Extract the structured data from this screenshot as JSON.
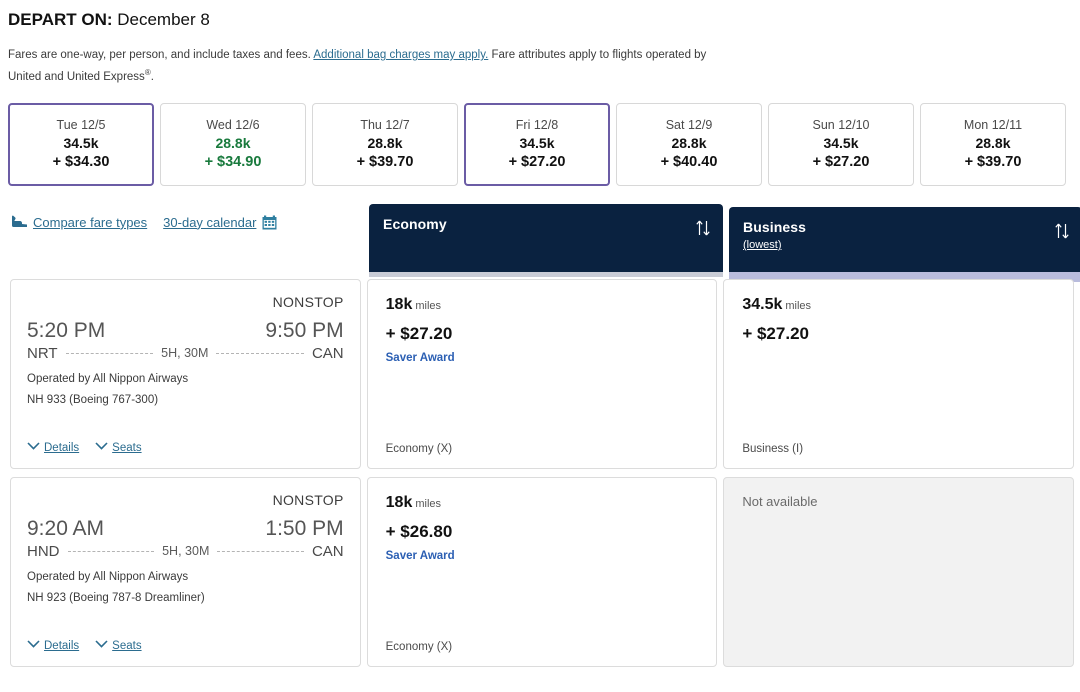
{
  "header": {
    "depart_label": "DEPART ON:",
    "depart_date": "December 8",
    "note_part1": "Fares are one-way, per person, and include taxes and fees.",
    "note_link": "Additional bag charges may apply.",
    "note_part2": "Fare attributes apply to flights operated by United and United Express",
    "note_sup": "®",
    "note_end": "."
  },
  "date_strip": [
    {
      "dow": "Tue 12/5",
      "miles": "34.5k",
      "cash": "+ $34.30",
      "selected": true,
      "lowest": false
    },
    {
      "dow": "Wed 12/6",
      "miles": "28.8k",
      "cash": "+ $34.90",
      "selected": false,
      "lowest": true
    },
    {
      "dow": "Thu 12/7",
      "miles": "28.8k",
      "cash": "+ $39.70",
      "selected": false,
      "lowest": false
    },
    {
      "dow": "Fri 12/8",
      "miles": "34.5k",
      "cash": "+ $27.20",
      "selected": true,
      "lowest": false
    },
    {
      "dow": "Sat 12/9",
      "miles": "28.8k",
      "cash": "+ $40.40",
      "selected": false,
      "lowest": false
    },
    {
      "dow": "Sun 12/10",
      "miles": "34.5k",
      "cash": "+ $27.20",
      "selected": false,
      "lowest": false
    },
    {
      "dow": "Mon 12/11",
      "miles": "28.8k",
      "cash": "+ $39.70",
      "selected": false,
      "lowest": false
    }
  ],
  "links": {
    "compare": "Compare fare types",
    "calendar": "30-day calendar"
  },
  "columns": {
    "economy": {
      "title": "Economy",
      "sub": ""
    },
    "business": {
      "title": "Business",
      "sub": "(lowest)"
    }
  },
  "flights": [
    {
      "stops": "NONSTOP",
      "depart_time": "5:20 PM",
      "arrive_time": "9:50 PM",
      "origin": "NRT",
      "destination": "CAN",
      "duration": "5H, 30M",
      "operated_by": "Operated by All Nippon Airways",
      "equipment": "NH 933 (Boeing 767-300)",
      "details_label": "Details",
      "seats_label": "Seats",
      "economy": {
        "available": true,
        "miles": "18k",
        "miles_unit": "miles",
        "cash": "+ $27.20",
        "tag": "Saver Award",
        "class": "Economy (X)"
      },
      "business": {
        "available": true,
        "miles": "34.5k",
        "miles_unit": "miles",
        "cash": "+ $27.20",
        "tag": "",
        "class": "Business (I)"
      }
    },
    {
      "stops": "NONSTOP",
      "depart_time": "9:20 AM",
      "arrive_time": "1:50 PM",
      "origin": "HND",
      "destination": "CAN",
      "duration": "5H, 30M",
      "operated_by": "Operated by All Nippon Airways",
      "equipment": "NH 923 (Boeing 787-8 Dreamliner)",
      "details_label": "Details",
      "seats_label": "Seats",
      "economy": {
        "available": true,
        "miles": "18k",
        "miles_unit": "miles",
        "cash": "+ $26.80",
        "tag": "Saver Award",
        "class": "Economy (X)"
      },
      "business": {
        "available": false,
        "not_available": "Not available"
      }
    }
  ],
  "colors": {
    "header_navy": "#0a2240",
    "selected_purple": "#6b5ca5",
    "lowest_green": "#197a3d",
    "link_blue": "#2b6c8f",
    "saver_blue": "#2b5fb3",
    "business_bar": "#b9bcdd"
  }
}
